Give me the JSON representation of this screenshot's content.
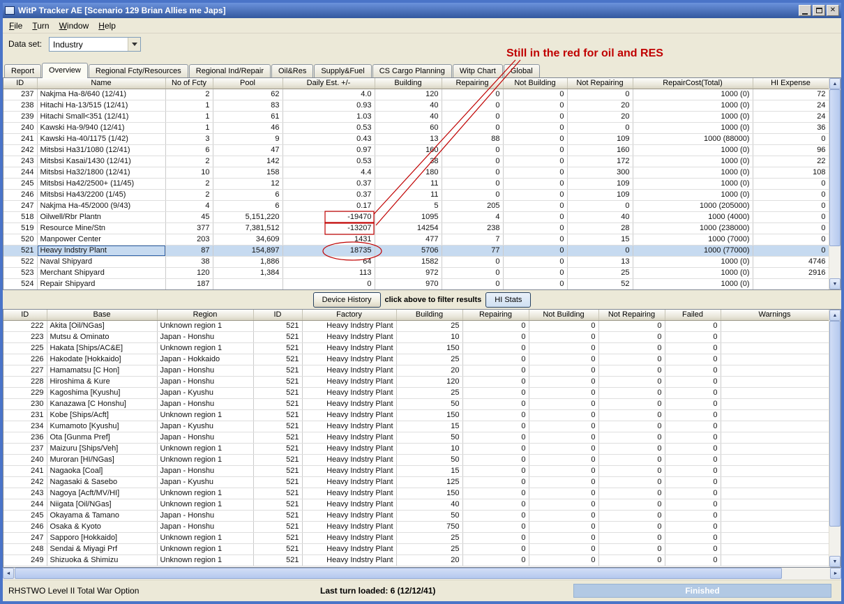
{
  "window": {
    "title": "WitP Tracker AE [Scenario 129 Brian Allies me Japs]"
  },
  "menu": {
    "items": [
      "File",
      "Turn",
      "Window",
      "Help"
    ]
  },
  "dataset": {
    "label": "Data set:",
    "value": "Industry"
  },
  "annotation": {
    "text": "Still in the red for oil and RES",
    "color": "#c00000",
    "boxed_values": [
      "-19470",
      "-13207"
    ],
    "circled_value": "18735"
  },
  "tabs": {
    "items": [
      "Report",
      "Overview",
      "Regional Fcty/Resources",
      "Regional Ind/Repair",
      "Oil&Res",
      "Supply&Fuel",
      "CS Cargo Planning",
      "Witp Chart",
      "Global"
    ],
    "selected": "Overview"
  },
  "top_table": {
    "columns": [
      "ID",
      "Name",
      "No of Fcty",
      "Pool",
      "Daily Est. +/-",
      "Building",
      "Repairing",
      "Not Building",
      "Not Repairing",
      "RepairCost(Total)",
      "HI Expense"
    ],
    "selected_id": "521",
    "rows": [
      [
        "237",
        "Nakjma Ha-8/640 (12/41)",
        "2",
        "62",
        "4.0",
        "120",
        "0",
        "0",
        "0",
        "1000 (0)",
        "72"
      ],
      [
        "238",
        "Hitachi Ha-13/515 (12/41)",
        "1",
        "83",
        "0.93",
        "40",
        "0",
        "0",
        "20",
        "1000 (0)",
        "24"
      ],
      [
        "239",
        "Hitachi Small<351 (12/41)",
        "1",
        "61",
        "1.03",
        "40",
        "0",
        "0",
        "20",
        "1000 (0)",
        "24"
      ],
      [
        "240",
        "Kawski Ha-9/940 (12/41)",
        "1",
        "46",
        "0.53",
        "60",
        "0",
        "0",
        "0",
        "1000 (0)",
        "36"
      ],
      [
        "241",
        "Kawski Ha-40/1175 (1/42)",
        "3",
        "9",
        "0.43",
        "13",
        "88",
        "0",
        "109",
        "1000 (88000)",
        "0"
      ],
      [
        "242",
        "Mitsbsi Ha31/1080 (12/41)",
        "6",
        "47",
        "0.97",
        "160",
        "0",
        "0",
        "160",
        "1000 (0)",
        "96"
      ],
      [
        "243",
        "Mitsbsi Kasai/1430 (12/41)",
        "2",
        "142",
        "0.53",
        "38",
        "0",
        "0",
        "172",
        "1000 (0)",
        "22"
      ],
      [
        "244",
        "Mitsbsi Ha32/1800 (12/41)",
        "10",
        "158",
        "4.4",
        "180",
        "0",
        "0",
        "300",
        "1000 (0)",
        "108"
      ],
      [
        "245",
        "Mitsbsi Ha42/2500+ (11/45)",
        "2",
        "12",
        "0.37",
        "11",
        "0",
        "0",
        "109",
        "1000 (0)",
        "0"
      ],
      [
        "246",
        "Mitsbsi Ha43/2200 (1/45)",
        "2",
        "6",
        "0.37",
        "11",
        "0",
        "0",
        "109",
        "1000 (0)",
        "0"
      ],
      [
        "247",
        "Nakjma Ha-45/2000 (9/43)",
        "4",
        "6",
        "0.17",
        "5",
        "205",
        "0",
        "0",
        "1000 (205000)",
        "0"
      ],
      [
        "518",
        "Oilwell/Rbr Plantn",
        "45",
        "5,151,220",
        "-19470",
        "1095",
        "4",
        "0",
        "40",
        "1000 (4000)",
        "0"
      ],
      [
        "519",
        "Resource Mine/Stn",
        "377",
        "7,381,512",
        "-13207",
        "14254",
        "238",
        "0",
        "28",
        "1000 (238000)",
        "0"
      ],
      [
        "520",
        "Manpower Center",
        "203",
        "34,609",
        "1431",
        "477",
        "7",
        "0",
        "15",
        "1000 (7000)",
        "0"
      ],
      [
        "521",
        "Heavy Indstry Plant",
        "87",
        "154,897",
        "18735",
        "5706",
        "77",
        "0",
        "0",
        "1000 (77000)",
        "0"
      ],
      [
        "522",
        "Naval Shipyard",
        "38",
        "1,886",
        "64",
        "1582",
        "0",
        "0",
        "13",
        "1000 (0)",
        "4746"
      ],
      [
        "523",
        "Merchant Shipyard",
        "120",
        "1,384",
        "113",
        "972",
        "0",
        "0",
        "25",
        "1000 (0)",
        "2916"
      ],
      [
        "524",
        "Repair Shipyard",
        "187",
        "",
        "0",
        "970",
        "0",
        "0",
        "52",
        "1000 (0)",
        ""
      ]
    ]
  },
  "filter_bar": {
    "device_history_button": "Device History",
    "hint": "click above to filter results",
    "hi_stats_button": "HI Stats"
  },
  "bottom_table": {
    "columns": [
      "ID",
      "Base",
      "Region",
      "ID",
      "Factory",
      "Building",
      "Repairing",
      "Not Building",
      "Not Repairing",
      "Failed",
      "Warnings"
    ],
    "rows": [
      [
        "222",
        "Akita [Oil/NGas]",
        "Unknown region 1",
        "521",
        "Heavy Indstry Plant",
        "25",
        "0",
        "0",
        "0",
        "0",
        ""
      ],
      [
        "223",
        "Mutsu & Ominato",
        "Japan - Honshu",
        "521",
        "Heavy Indstry Plant",
        "10",
        "0",
        "0",
        "0",
        "0",
        ""
      ],
      [
        "225",
        "Hakata [Ships/AC&E]",
        "Unknown region 1",
        "521",
        "Heavy Indstry Plant",
        "150",
        "0",
        "0",
        "0",
        "0",
        ""
      ],
      [
        "226",
        "Hakodate [Hokkaido]",
        "Japan - Hokkaido",
        "521",
        "Heavy Indstry Plant",
        "25",
        "0",
        "0",
        "0",
        "0",
        ""
      ],
      [
        "227",
        "Hamamatsu [C Hon]",
        "Japan - Honshu",
        "521",
        "Heavy Indstry Plant",
        "20",
        "0",
        "0",
        "0",
        "0",
        ""
      ],
      [
        "228",
        "Hiroshima & Kure",
        "Japan - Honshu",
        "521",
        "Heavy Indstry Plant",
        "120",
        "0",
        "0",
        "0",
        "0",
        ""
      ],
      [
        "229",
        "Kagoshima [Kyushu]",
        "Japan - Kyushu",
        "521",
        "Heavy Indstry Plant",
        "25",
        "0",
        "0",
        "0",
        "0",
        ""
      ],
      [
        "230",
        "Kanazawa [C Honshu]",
        "Japan - Honshu",
        "521",
        "Heavy Indstry Plant",
        "50",
        "0",
        "0",
        "0",
        "0",
        ""
      ],
      [
        "231",
        "Kobe [Ships/Acft]",
        "Unknown region 1",
        "521",
        "Heavy Indstry Plant",
        "150",
        "0",
        "0",
        "0",
        "0",
        ""
      ],
      [
        "234",
        "Kumamoto [Kyushu]",
        "Japan - Kyushu",
        "521",
        "Heavy Indstry Plant",
        "15",
        "0",
        "0",
        "0",
        "0",
        ""
      ],
      [
        "236",
        "Ota [Gunma Pref]",
        "Japan - Honshu",
        "521",
        "Heavy Indstry Plant",
        "50",
        "0",
        "0",
        "0",
        "0",
        ""
      ],
      [
        "237",
        "Maizuru [Ships/Veh]",
        "Unknown region 1",
        "521",
        "Heavy Indstry Plant",
        "10",
        "0",
        "0",
        "0",
        "0",
        ""
      ],
      [
        "240",
        "Muroran [HI/NGas]",
        "Unknown region 1",
        "521",
        "Heavy Indstry Plant",
        "50",
        "0",
        "0",
        "0",
        "0",
        ""
      ],
      [
        "241",
        "Nagaoka [Coal]",
        "Japan - Honshu",
        "521",
        "Heavy Indstry Plant",
        "15",
        "0",
        "0",
        "0",
        "0",
        ""
      ],
      [
        "242",
        "Nagasaki & Sasebo",
        "Japan - Kyushu",
        "521",
        "Heavy Indstry Plant",
        "125",
        "0",
        "0",
        "0",
        "0",
        ""
      ],
      [
        "243",
        "Nagoya [Acft/MV/HI]",
        "Unknown region 1",
        "521",
        "Heavy Indstry Plant",
        "150",
        "0",
        "0",
        "0",
        "0",
        ""
      ],
      [
        "244",
        "Niigata [Oil/NGas]",
        "Unknown region 1",
        "521",
        "Heavy Indstry Plant",
        "40",
        "0",
        "0",
        "0",
        "0",
        ""
      ],
      [
        "245",
        "Okayama & Tamano",
        "Japan - Honshu",
        "521",
        "Heavy Indstry Plant",
        "50",
        "0",
        "0",
        "0",
        "0",
        ""
      ],
      [
        "246",
        "Osaka & Kyoto",
        "Japan - Honshu",
        "521",
        "Heavy Indstry Plant",
        "750",
        "0",
        "0",
        "0",
        "0",
        ""
      ],
      [
        "247",
        "Sapporo [Hokkaido]",
        "Unknown region 1",
        "521",
        "Heavy Indstry Plant",
        "25",
        "0",
        "0",
        "0",
        "0",
        ""
      ],
      [
        "248",
        "Sendai & Miyagi Prf",
        "Unknown region 1",
        "521",
        "Heavy Indstry Plant",
        "25",
        "0",
        "0",
        "0",
        "0",
        ""
      ],
      [
        "249",
        "Shizuoka & Shimizu",
        "Unknown region 1",
        "521",
        "Heavy Indstry Plant",
        "20",
        "0",
        "0",
        "0",
        "0",
        ""
      ]
    ]
  },
  "status_bar": {
    "left": "RHSTWO Level II Total War Option",
    "center": "Last turn loaded: 6 (12/12/41)",
    "finished_label": "Finished"
  }
}
